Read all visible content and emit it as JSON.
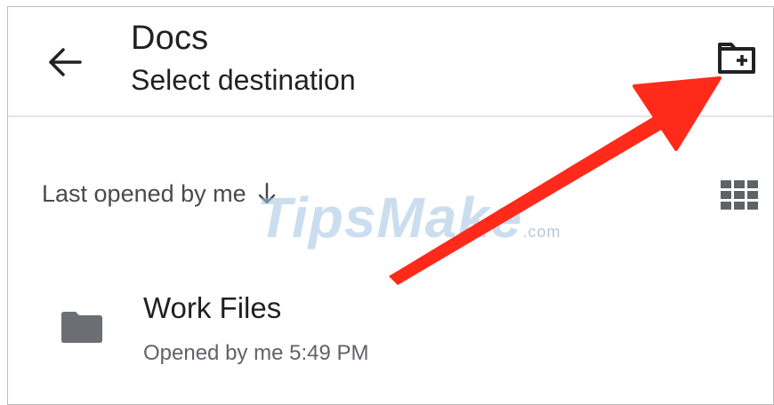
{
  "header": {
    "title": "Docs",
    "subtitle": "Select destination",
    "back_icon": "arrow-back-icon",
    "new_folder_icon": "folder-plus-icon"
  },
  "sort": {
    "label": "Last opened by me",
    "direction_icon": "arrow-down-icon",
    "view_icon": "grid-view-icon"
  },
  "watermark": {
    "text": "TipsMake",
    "suffix": ".com"
  },
  "files": [
    {
      "name": "Work Files",
      "meta": "Opened by me 5:49 PM",
      "icon": "folder-icon"
    }
  ],
  "colors": {
    "annotation_arrow": "#ff2a1a",
    "folder_icon": "#5f6368",
    "text_primary": "#202124",
    "text_secondary": "#5f6368"
  }
}
